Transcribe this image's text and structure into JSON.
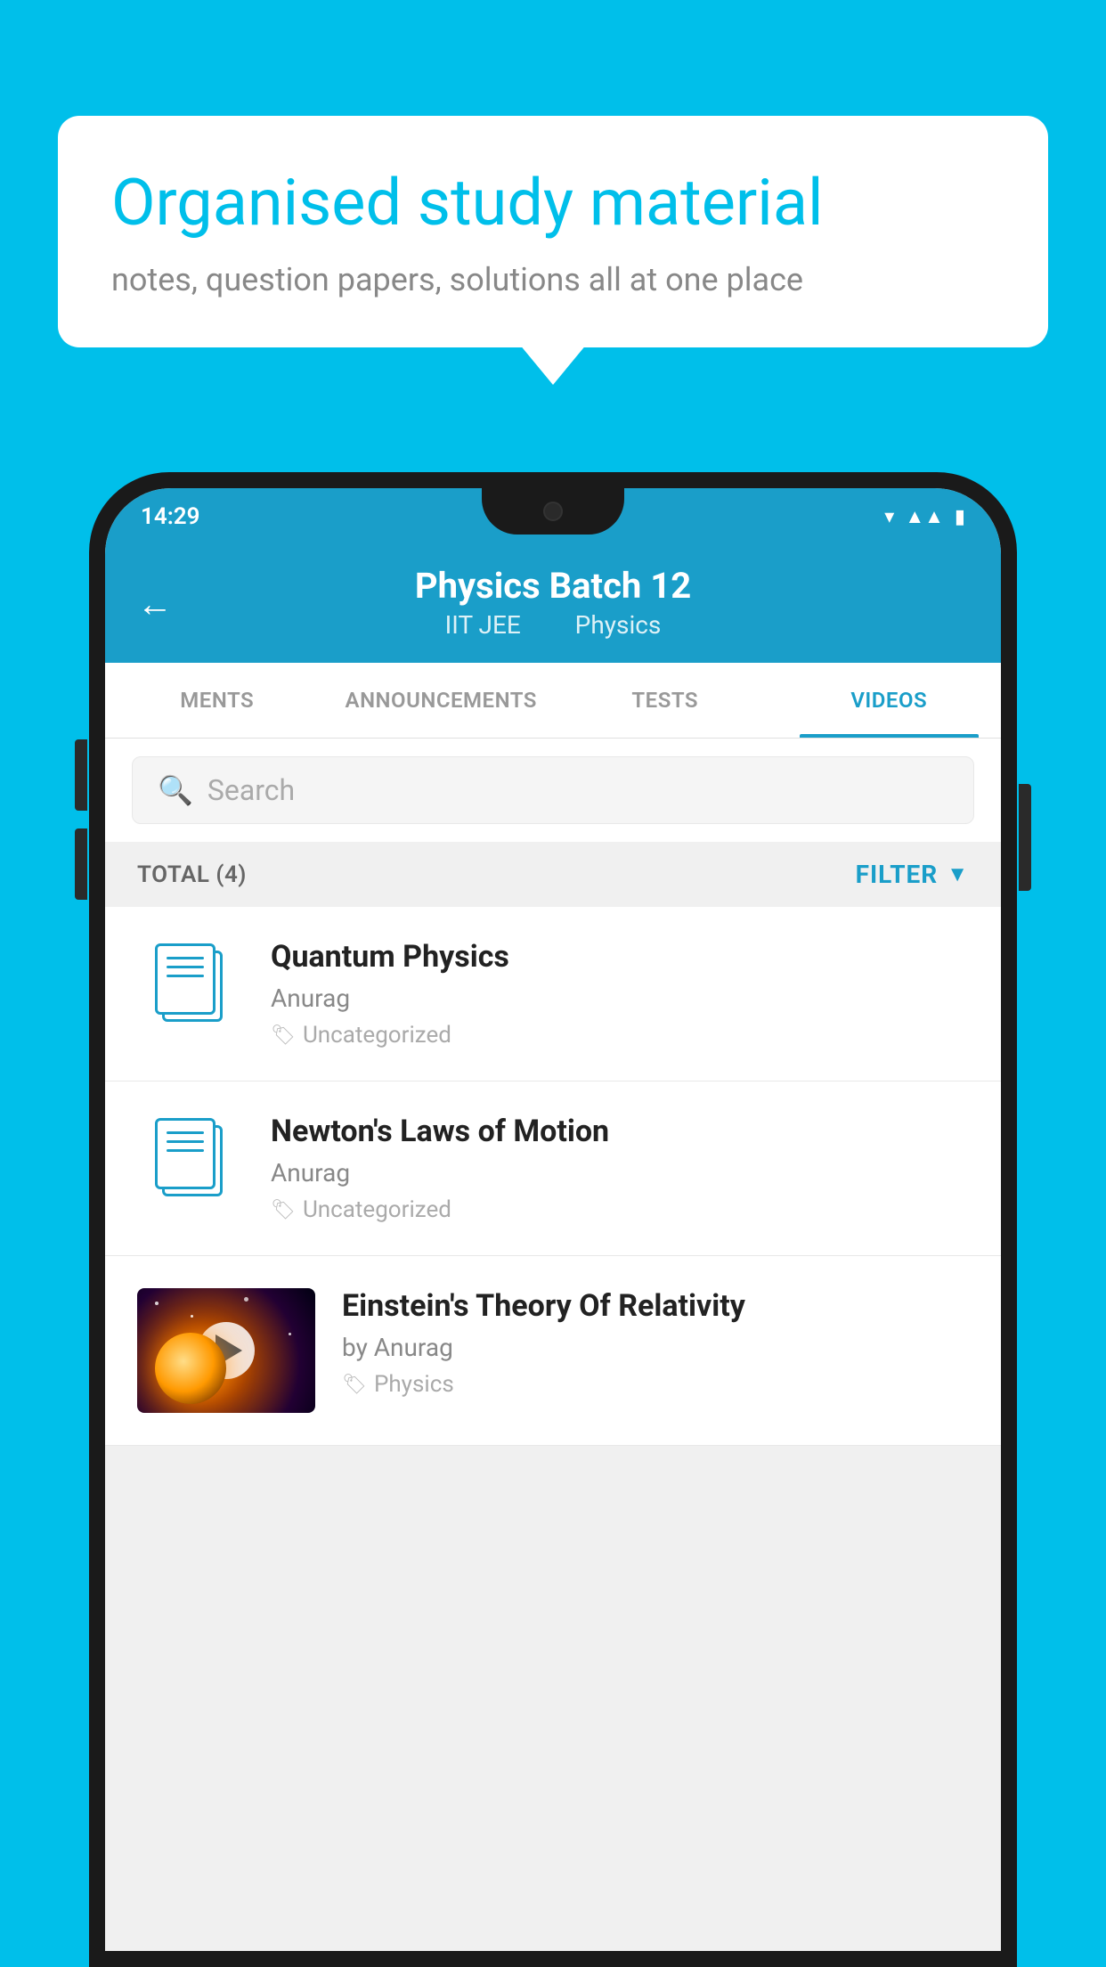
{
  "background": {
    "color": "#00BFEA"
  },
  "bubble": {
    "title": "Organised study material",
    "subtitle": "notes, question papers, solutions all at one place"
  },
  "phone": {
    "status_bar": {
      "time": "14:29"
    },
    "header": {
      "title": "Physics Batch 12",
      "subtitle_part1": "IIT JEE",
      "subtitle_part2": "Physics",
      "back_label": "←"
    },
    "tabs": [
      {
        "label": "MENTS",
        "active": false
      },
      {
        "label": "ANNOUNCEMENTS",
        "active": false
      },
      {
        "label": "TESTS",
        "active": false
      },
      {
        "label": "VIDEOS",
        "active": true
      }
    ],
    "search": {
      "placeholder": "Search"
    },
    "filter_bar": {
      "total_label": "TOTAL (4)",
      "filter_label": "FILTER"
    },
    "videos": [
      {
        "title": "Quantum Physics",
        "author": "Anurag",
        "tag": "Uncategorized",
        "has_thumbnail": false
      },
      {
        "title": "Newton's Laws of Motion",
        "author": "Anurag",
        "tag": "Uncategorized",
        "has_thumbnail": false
      },
      {
        "title": "Einstein's Theory Of Relativity",
        "author": "by Anurag",
        "tag": "Physics",
        "has_thumbnail": true
      }
    ]
  }
}
